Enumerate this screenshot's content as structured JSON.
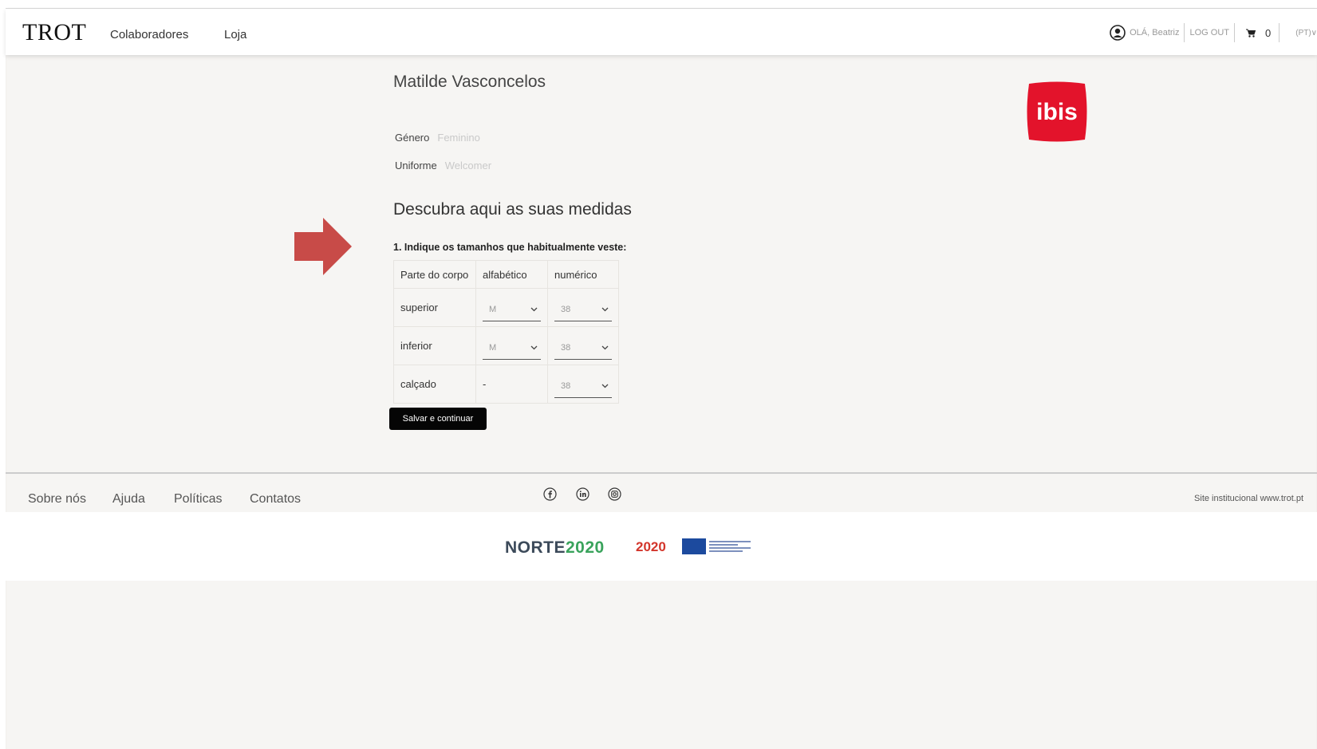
{
  "header": {
    "logo": "TROT",
    "nav": [
      "Colaboradores",
      "Loja"
    ],
    "greeting": "OLÁ, Beatriz",
    "logout": "LOG OUT",
    "cart_count": "0",
    "language": "(PT)∨"
  },
  "profile": {
    "name": "Matilde Vasconcelos",
    "gender_label": "Género",
    "gender_value": "Feminino",
    "uniform_label": "Uniforme",
    "uniform_value": "Welcomer",
    "brand_logo": "ibis",
    "brand_color": "#e3132b"
  },
  "measurements": {
    "title": "Descubra aqui as suas medidas",
    "question": "1. Indique os tamanhos que habitualmente veste:",
    "headers": [
      "Parte do corpo",
      "alfabético",
      "numérico"
    ],
    "rows": [
      {
        "part": "superior",
        "alpha": "M",
        "numeric": "38"
      },
      {
        "part": "inferior",
        "alpha": "M",
        "numeric": "38"
      },
      {
        "part": "calçado",
        "alpha": "-",
        "numeric": "38"
      }
    ],
    "save_label": "Salvar e continuar",
    "arrow_color": "#c84b48"
  },
  "footer": {
    "links": [
      "Sobre nós",
      "Ajuda",
      "Políticas",
      "Contatos"
    ],
    "social_icons": [
      "facebook-icon",
      "linkedin-icon",
      "instagram-icon"
    ],
    "site_link": "Site institucional www.trot.pt",
    "funding_norte_a": "NORTE",
    "funding_norte_b": "2020",
    "funding_portugal": "2020"
  }
}
